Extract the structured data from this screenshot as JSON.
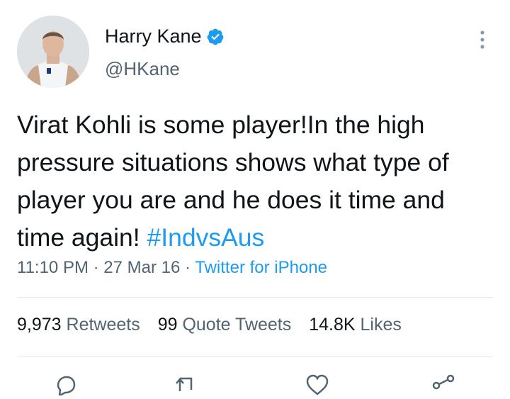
{
  "author": {
    "name": "Harry Kane",
    "handle": "@HKane",
    "verified": true,
    "avatar_icon": "profile-photo"
  },
  "tweet": {
    "text": "Virat Kohli is some player!In the high pressure situations shows what type of player you are and he does it time and time again! ",
    "hashtag": "#IndvsAus",
    "time": "11:10 PM",
    "date": "27 Mar 16",
    "separator": "·",
    "source": "Twitter for iPhone"
  },
  "stats": {
    "retweets_count": "9,973",
    "retweets_label": "Retweets",
    "quotes_count": "99",
    "quotes_label": "Quote Tweets",
    "likes_count": "14.8K",
    "likes_label": "Likes"
  },
  "colors": {
    "accent": "#1d9bf0",
    "secondary_text": "#536471",
    "primary_text": "#0f1419",
    "divider": "#e6e9eb"
  },
  "icons": [
    "more-options-icon",
    "verified-badge-icon",
    "reply-icon",
    "retweet-icon",
    "like-icon",
    "share-icon"
  ]
}
